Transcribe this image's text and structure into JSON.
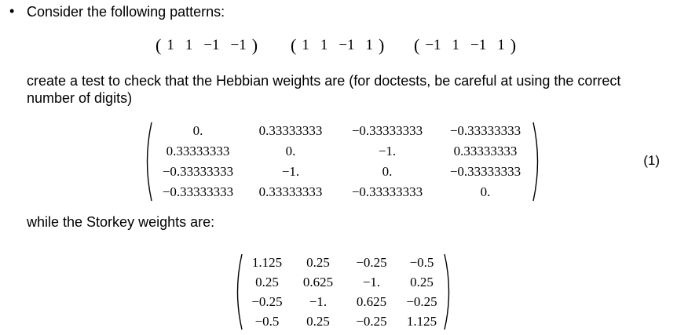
{
  "bullet": "•",
  "intro_text": "Consider the following patterns:",
  "patterns": [
    [
      "1",
      "1",
      "−1",
      "−1"
    ],
    [
      "1",
      "1",
      "−1",
      "1"
    ],
    [
      "−1",
      "1",
      "−1",
      "1"
    ]
  ],
  "paragraph": "create a test to check that the Hebbian weights are (for doctests, be careful at using the correct number of digits)",
  "hebbian_matrix": [
    [
      "0.",
      "0.33333333",
      "−0.33333333",
      "−0.33333333"
    ],
    [
      "0.33333333",
      "0.",
      "−1.",
      "0.33333333"
    ],
    [
      "−0.33333333",
      "−1.",
      "0.",
      "−0.33333333"
    ],
    [
      "−0.33333333",
      "0.33333333",
      "−0.33333333",
      "0."
    ]
  ],
  "equation_number": "(1)",
  "storkey_text": "while the Storkey weights are:",
  "storkey_matrix": [
    [
      "1.125",
      "0.25",
      "−0.25",
      "−0.5"
    ],
    [
      "0.25",
      "0.625",
      "−1.",
      "0.25"
    ],
    [
      "−0.25",
      "−1.",
      "0.625",
      "−0.25"
    ],
    [
      "−0.5",
      "0.25",
      "−0.25",
      "1.125"
    ]
  ]
}
